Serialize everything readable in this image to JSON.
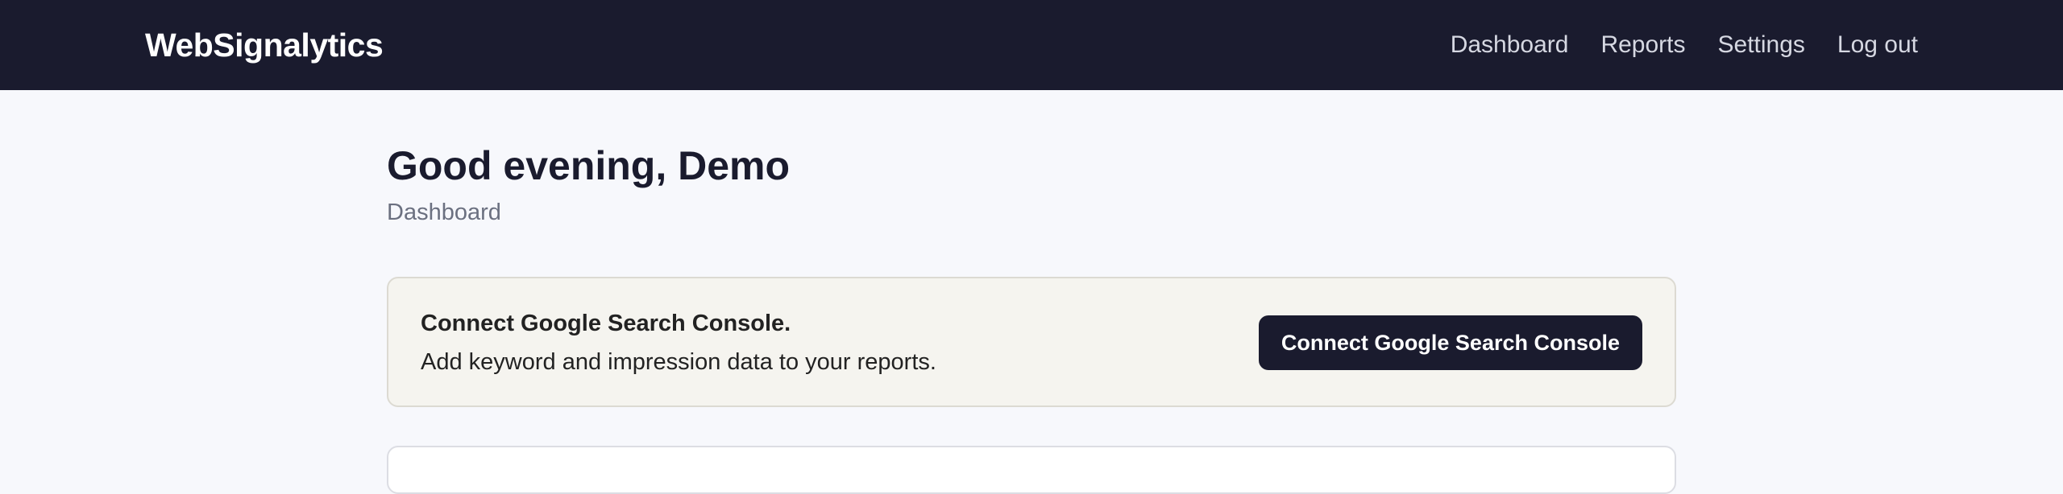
{
  "header": {
    "brand": "WebSignalytics",
    "nav": [
      {
        "label": "Dashboard"
      },
      {
        "label": "Reports"
      },
      {
        "label": "Settings"
      },
      {
        "label": "Log out"
      }
    ]
  },
  "main": {
    "greeting": "Good evening, Demo",
    "subtitle": "Dashboard",
    "gsc_card": {
      "title": "Connect Google Search Console.",
      "description": "Add keyword and impression data to your reports.",
      "button_label": "Connect Google Search Console"
    }
  },
  "colors": {
    "nav_background": "#1a1b2e",
    "page_background": "#f7f8fc",
    "card_background": "#f5f4ef",
    "button_background": "#1a1b2e"
  }
}
